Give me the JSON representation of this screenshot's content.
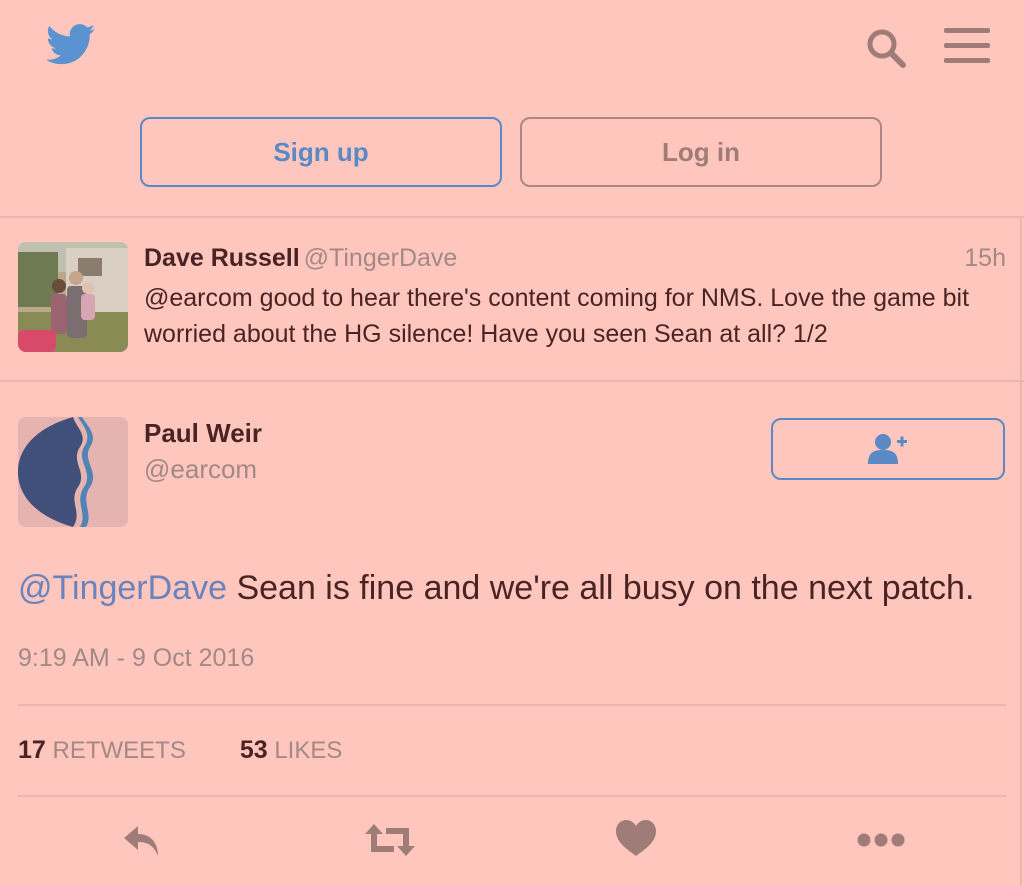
{
  "header": {
    "logo_icon": "twitter-bird-icon",
    "search_icon": "search-icon",
    "menu_icon": "hamburger-menu-icon",
    "signup_label": "Sign up",
    "login_label": "Log in"
  },
  "reply_tweet": {
    "author_name": "Dave Russell",
    "author_handle": "@TingerDave",
    "time": "15h",
    "text": "@earcom good to hear there's content coming for NMS. Love the game bit worried about the HG silence! Have you seen Sean at all? 1/2"
  },
  "main_tweet": {
    "author_name": "Paul Weir",
    "author_handle": "@earcom",
    "follow_icon": "follow-user-icon",
    "mention": "@TingerDave",
    "text": " Sean is fine and we're all busy on the next patch.",
    "timestamp": "9:19 AM - 9 Oct 2016",
    "retweets_count": "17",
    "retweets_label": "RETWEETS",
    "likes_count": "53",
    "likes_label": "LIKES"
  },
  "actions": {
    "reply_icon": "reply-icon",
    "retweet_icon": "retweet-icon",
    "like_icon": "heart-icon",
    "more_icon": "more-dots-icon"
  },
  "colors": {
    "background": "#fec6bd",
    "accent": "#5a89c6",
    "text": "#4a2424",
    "muted": "#a38885"
  }
}
